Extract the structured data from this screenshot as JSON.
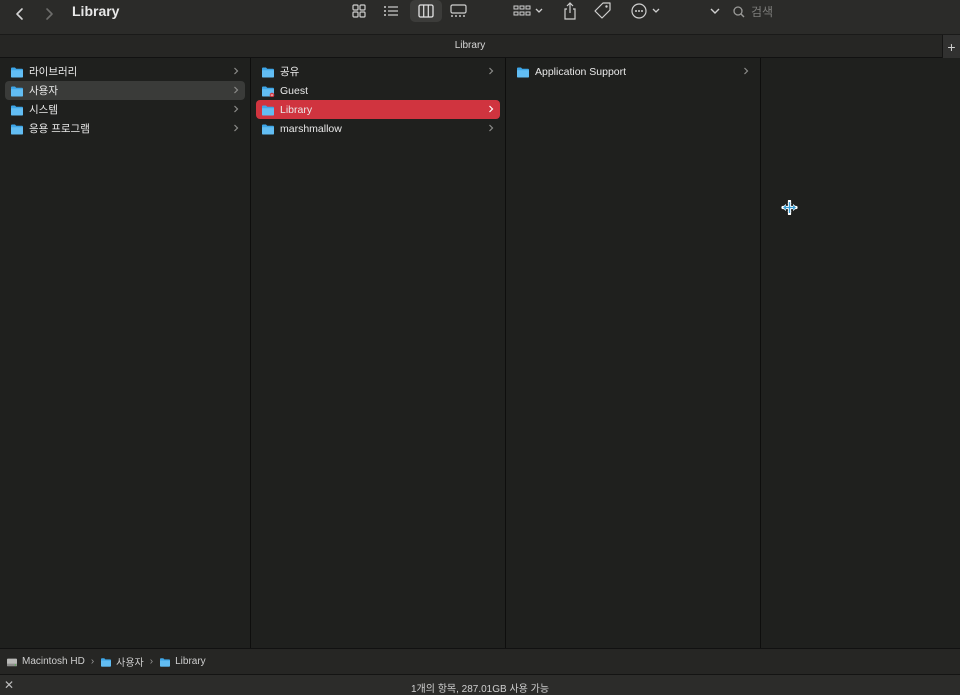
{
  "window": {
    "title": "Library"
  },
  "toolbar": {
    "back_icon": "chevron-left-icon",
    "forward_icon": "chevron-right-icon",
    "views": [
      "icon-view-icon",
      "list-view-icon",
      "column-view-icon",
      "gallery-view-icon"
    ],
    "selected_view": "column-view-icon",
    "group_icon": "group-icon",
    "share_icon": "share-icon",
    "tag_icon": "tag-icon",
    "more_icon": "more-icon",
    "search_placeholder": "검색"
  },
  "tab": {
    "title": "Library"
  },
  "columns": {
    "col1": [
      {
        "label": "라이브러리",
        "has_children": true,
        "selected": false
      },
      {
        "label": "사용자",
        "has_children": true,
        "selected": true
      },
      {
        "label": "시스템",
        "has_children": true,
        "selected": false
      },
      {
        "label": "응용 프로그램",
        "has_children": true,
        "selected": false
      }
    ],
    "col2": [
      {
        "label": "공유",
        "has_children": true,
        "selected": false
      },
      {
        "label": "Guest",
        "has_children": false,
        "selected": false
      },
      {
        "label": "Library",
        "has_children": true,
        "selected": true
      },
      {
        "label": "marshmallow",
        "has_children": true,
        "selected": false
      }
    ],
    "col3": [
      {
        "label": "Application Support",
        "has_children": true,
        "selected": false
      }
    ]
  },
  "pathbar": {
    "crumbs": [
      "Macintosh HD",
      "사용자",
      "Library"
    ],
    "separator": "›"
  },
  "status": {
    "text": "1개의 항목, 287.01GB 사용 가능",
    "close_label": "✕"
  },
  "colors": {
    "accent_selection": "#d0343f",
    "inactive_selection": "#3a3b39",
    "folder": "#3ea6e8",
    "background": "#1f201e"
  }
}
